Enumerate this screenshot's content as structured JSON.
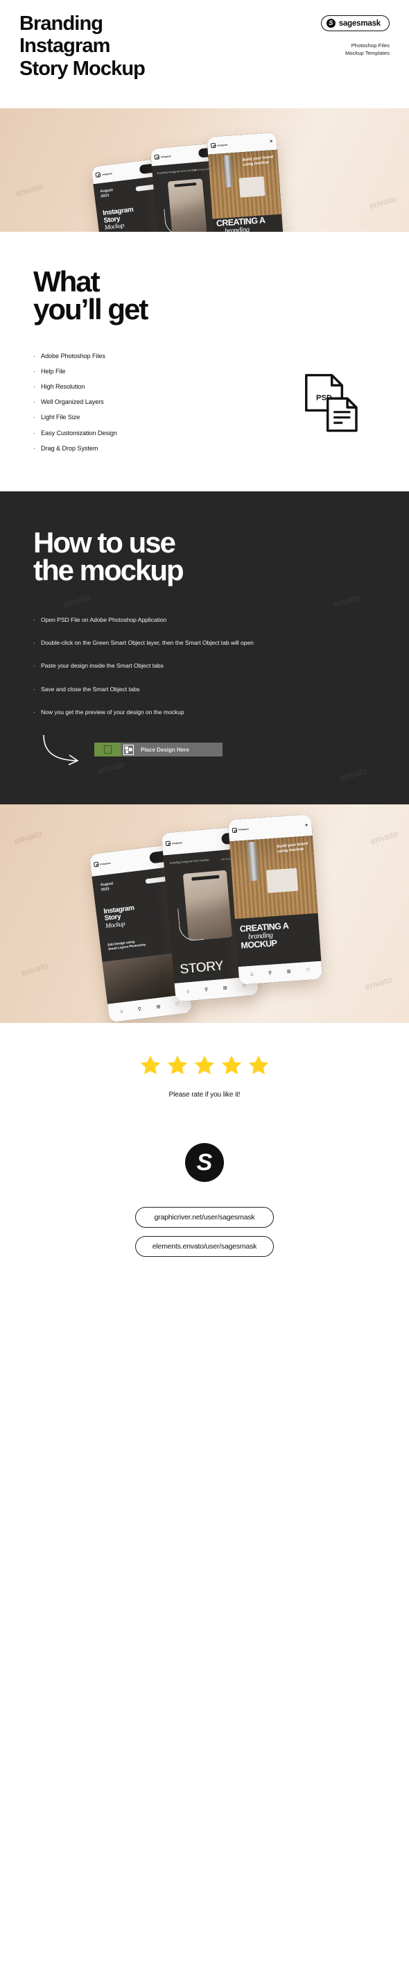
{
  "header": {
    "title_line1": "Branding",
    "title_line2": "Instagram",
    "title_line3": "Story Mockup",
    "brand_mark": "S",
    "brand_name": "sagesmask",
    "sub_line1": "Photoshop Files",
    "sub_line2": "Mockup Templates"
  },
  "hero": {
    "phone1": {
      "ig_word": "instagram",
      "date_line1": "August",
      "date_line2": "2023",
      "headline_line1": "Instagram",
      "headline_line2": "Story",
      "headline_line3": "Mockup",
      "sub_line1": "Edit Design using",
      "sub_line2": "Smart Layers Photoshop"
    },
    "phone2": {
      "ig_word": "instagram",
      "note_left": "branding instagram\nstory mockup",
      "note_right": "edit design\nphotoshop",
      "big_word": "STORY"
    },
    "phone3": {
      "ig_word": "instagram",
      "top_line1": "Build your brand",
      "top_line2": "using mockup",
      "big_line1": "CREATING A",
      "big_line2": "branding",
      "big_line3": "MOCKUP"
    },
    "watermark": "envato"
  },
  "what_you_get": {
    "title_line1": "What",
    "title_line2": "you’ll get",
    "items": [
      "Adobe Photoshop Files",
      "Help File",
      "High Resolution",
      "Well Organized Layers",
      "Light File Size",
      "Easy Customization Design",
      "Drag & Drop System"
    ],
    "psd_label": "PSD"
  },
  "how_to_use": {
    "title_line1": "How to use",
    "title_line2": "the mockup",
    "steps": [
      "Open PSD File on Adobe Photoshop Application",
      "Double-click on the Green Smart Object layer, then the Smart Object tab will open",
      "Paste your design inside the Smart Object tabs",
      "Save and close the Smart Object tabs",
      "Now you get the preview of your design on the mockup"
    ],
    "layer_label": "Place Design Here"
  },
  "rate": {
    "star_count": 5,
    "star_color": "#FFD21E",
    "text": "Please rate if you like it!"
  },
  "footer": {
    "avatar_letter": "S",
    "links": [
      "graphicriver.net/user/sagesmask",
      "elements.envato/user/sagesmask"
    ]
  }
}
